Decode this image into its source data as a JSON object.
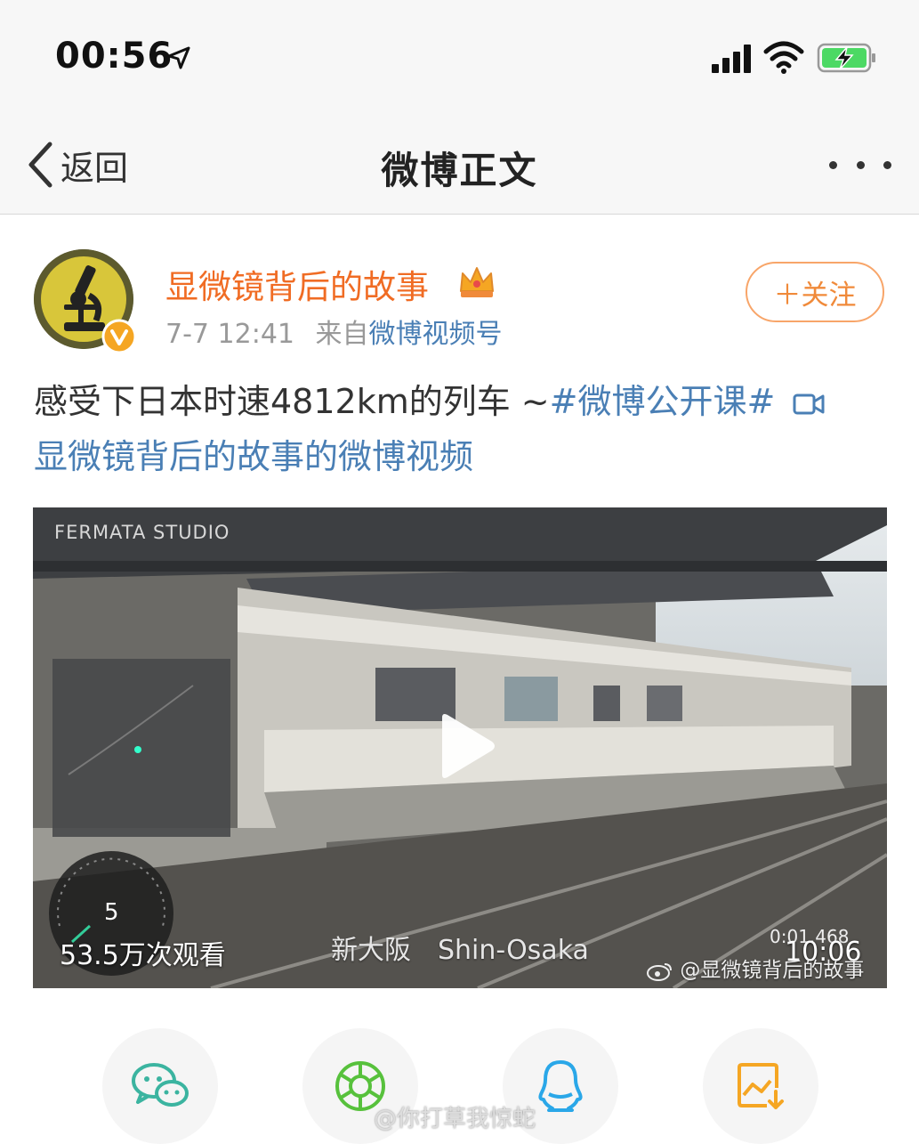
{
  "status_bar": {
    "time": "00:56",
    "icons": [
      "location-arrow-icon",
      "signal-icon",
      "wifi-icon",
      "battery-charging-icon"
    ],
    "battery_color": "#4cd964"
  },
  "nav": {
    "back_label": "返回",
    "title": "微博正文",
    "more_icon": "more-dots-icon"
  },
  "post": {
    "username": "显微镜背后的故事",
    "username_color": "#f06c24",
    "timestamp": "7-7 12:41",
    "source_prefix": "来自",
    "source": "微博视频号",
    "follow_label": "＋关注",
    "text": "感受下日本时速4812km的列车 ~",
    "hashtag": "#微博公开课#",
    "video_link": "显微镜背后的故事的微博视频",
    "link_color": "#4a7fb5"
  },
  "video": {
    "studio_watermark": "FERMATA STUDIO",
    "views": "53.5万次观看",
    "station": "新大阪　Shin-Osaka",
    "timecode": "0:01.468",
    "duration": "10:06",
    "weibo_watermark": "@显微镜背后的故事",
    "speed": "5"
  },
  "share": {
    "items": [
      "wechat-icon",
      "moments-icon",
      "qq-icon",
      "save-image-icon"
    ]
  },
  "bottom_watermark": "@你打草我惊蛇"
}
